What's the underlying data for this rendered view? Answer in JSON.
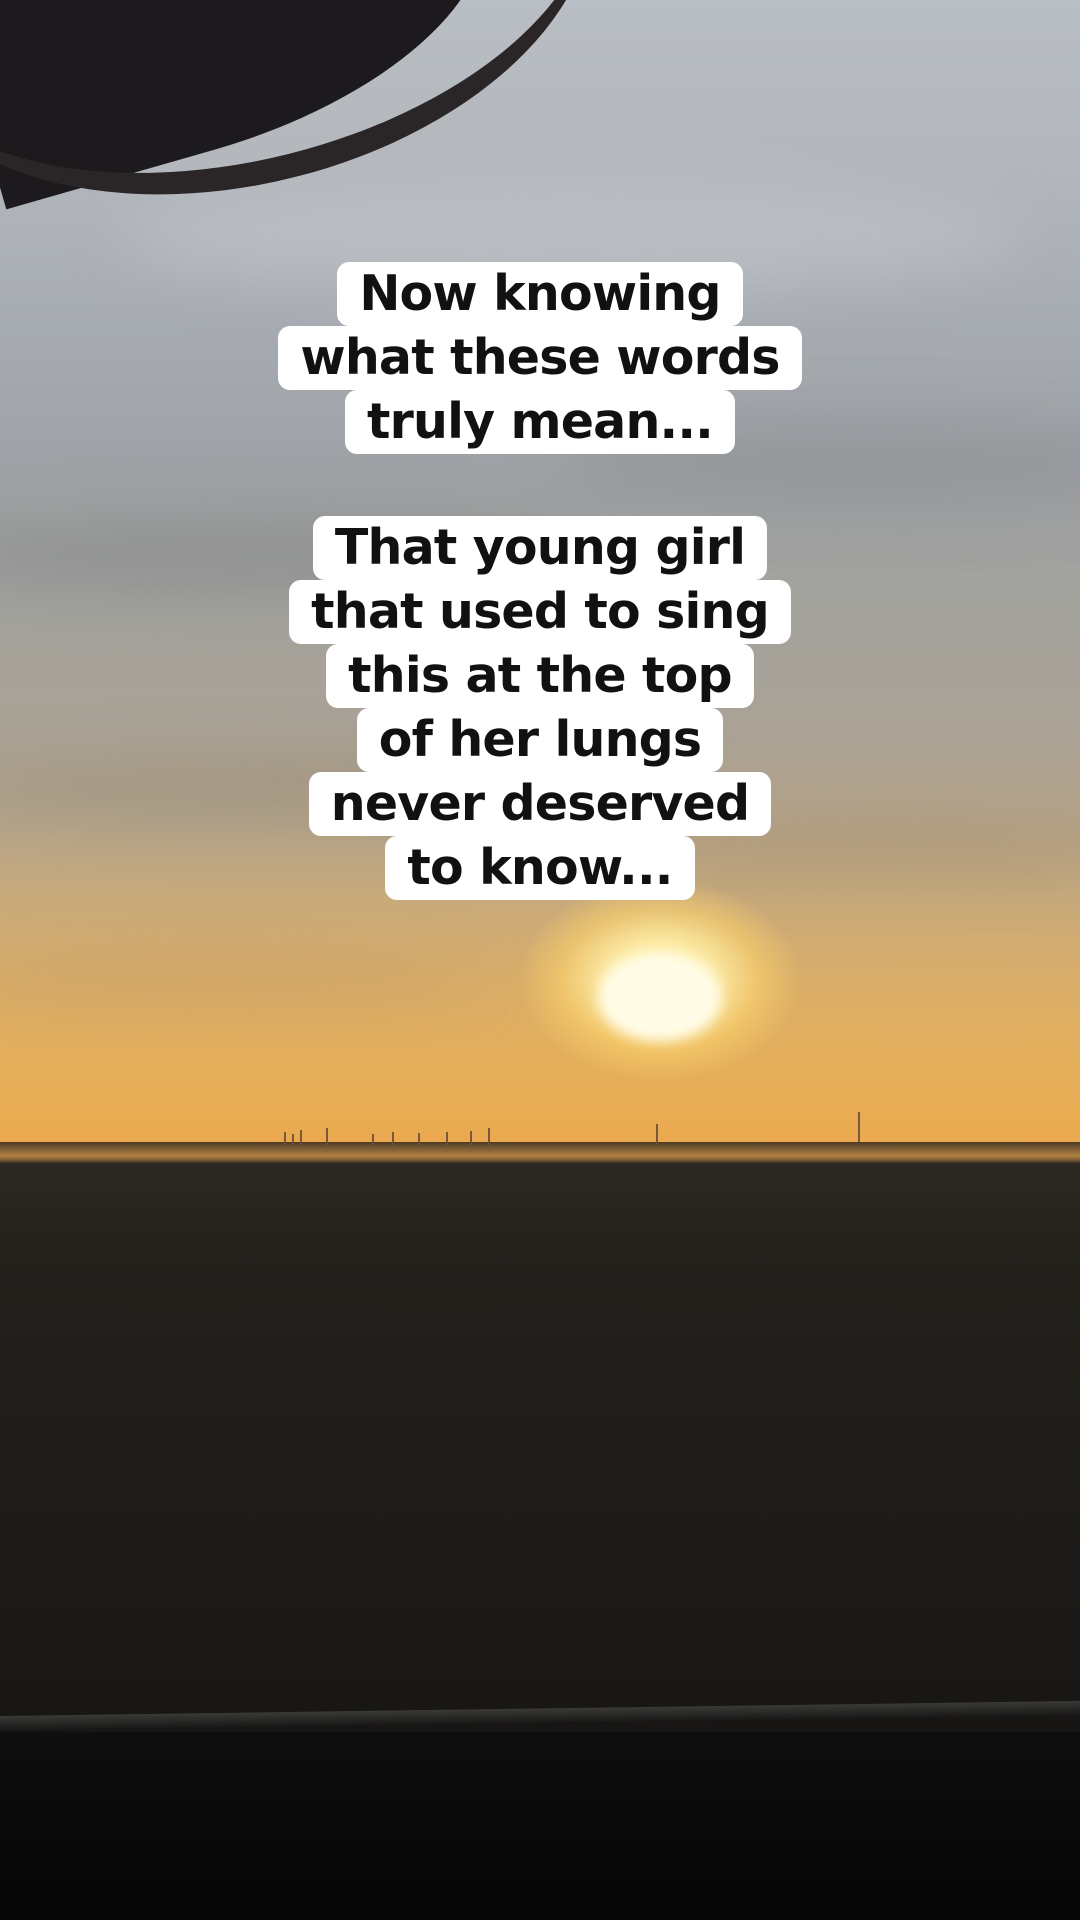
{
  "overlay_caption": {
    "block1": {
      "lines": [
        "Now knowing",
        "what these words",
        "truly mean..."
      ]
    },
    "block2": {
      "lines": [
        "That young girl",
        "that used to sing",
        "this at the top",
        "of her lungs",
        "never deserved",
        "to know..."
      ]
    }
  },
  "scene": {
    "subject": "sunset over flat field seen through car window",
    "colors": {
      "sky_top": "#b9bec4",
      "sky_glow": "#eaa74d",
      "ground": "#24211d",
      "caption_bg": "#ffffff",
      "caption_text": "#111111"
    }
  }
}
